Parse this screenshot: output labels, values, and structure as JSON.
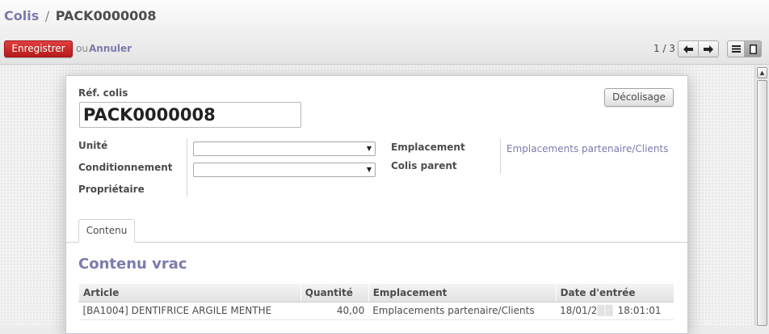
{
  "breadcrumb": {
    "parent": "Colis",
    "separator": "/",
    "current": "PACK0000008"
  },
  "toolbar": {
    "save_label": "Enregistrer",
    "or_text": "ou",
    "cancel_label": "Annuler",
    "pager": "1 / 3"
  },
  "form": {
    "ref_label": "Réf. colis",
    "ref_value": "PACK0000008",
    "unpack_button": "Décolisage",
    "unit_label": "Unité",
    "packaging_label": "Conditionnement",
    "owner_label": "Propriétaire",
    "location_label": "Emplacement",
    "location_value": "Emplacements partenaire/Clients",
    "parent_label": "Colis parent"
  },
  "tabs": [
    {
      "label": "Contenu"
    }
  ],
  "content": {
    "title": "Contenu vrac",
    "columns": [
      "Article",
      "Quantité",
      "Emplacement",
      "Date d'entrée"
    ],
    "rows": [
      {
        "article": "[BA1004] DENTIFRICE ARGILE MENTHE",
        "quantity": "40,00",
        "location": "Emplacements partenaire/Clients",
        "date_start": "18/01/2",
        "date_end": "18:01:01"
      }
    ]
  },
  "icons": {
    "prev": "arrow-left-icon",
    "next": "arrow-right-icon",
    "list_view": "list-icon",
    "form_view": "form-icon",
    "select_caret": "caret-down-icon"
  },
  "colors": {
    "accent": "#7c7bad",
    "save_button": "#c9252c"
  }
}
